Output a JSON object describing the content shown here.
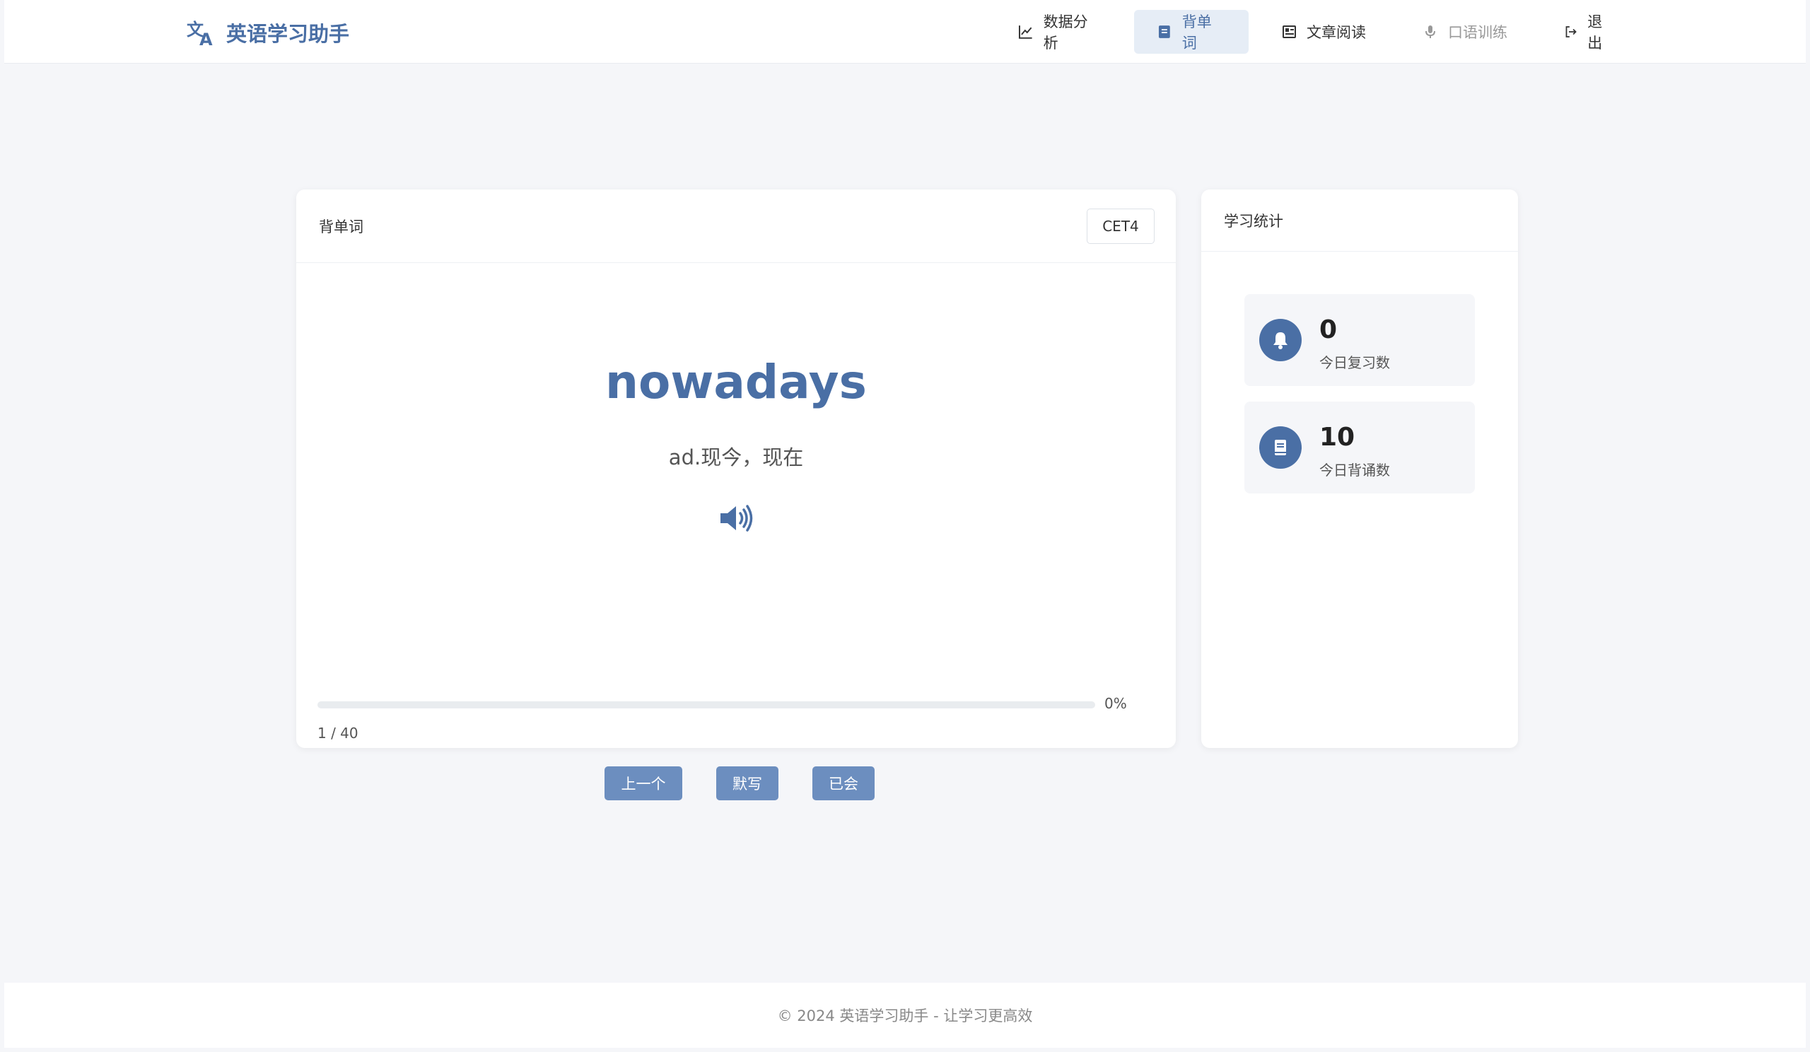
{
  "app": {
    "title": "英语学习助手"
  },
  "nav": {
    "items": [
      {
        "label": "数据分析",
        "icon": "chart-line-icon"
      },
      {
        "label": "背单词",
        "icon": "book-icon",
        "active": true
      },
      {
        "label": "文章阅读",
        "icon": "newspaper-icon"
      },
      {
        "label": "口语训练",
        "icon": "microphone-icon",
        "disabled": true
      },
      {
        "label": "退出",
        "icon": "sign-out-icon"
      }
    ]
  },
  "word_card": {
    "title": "背单词",
    "level": "CET4",
    "word": "nowadays",
    "meaning": "ad.现今，现在",
    "speaker_icon": "volume-icon",
    "progress": {
      "percent": 0,
      "percent_label": "0%",
      "counter": "1 / 40"
    },
    "buttons": {
      "prev": "上一个",
      "dictation": "默写",
      "known": "已会"
    }
  },
  "stats": {
    "title": "学习统计",
    "items": [
      {
        "value": "0",
        "label": "今日复习数",
        "icon": "bell-icon"
      },
      {
        "value": "10",
        "label": "今日背诵数",
        "icon": "book-icon"
      }
    ]
  },
  "footer": {
    "text": "© 2024 英语学习助手 - 让学习更高效"
  },
  "colors": {
    "accent": "#4a6fa5",
    "button": "#6c8ebf",
    "nav_active_bg": "#e6edf6",
    "page_bg": "#f5f6f9"
  }
}
